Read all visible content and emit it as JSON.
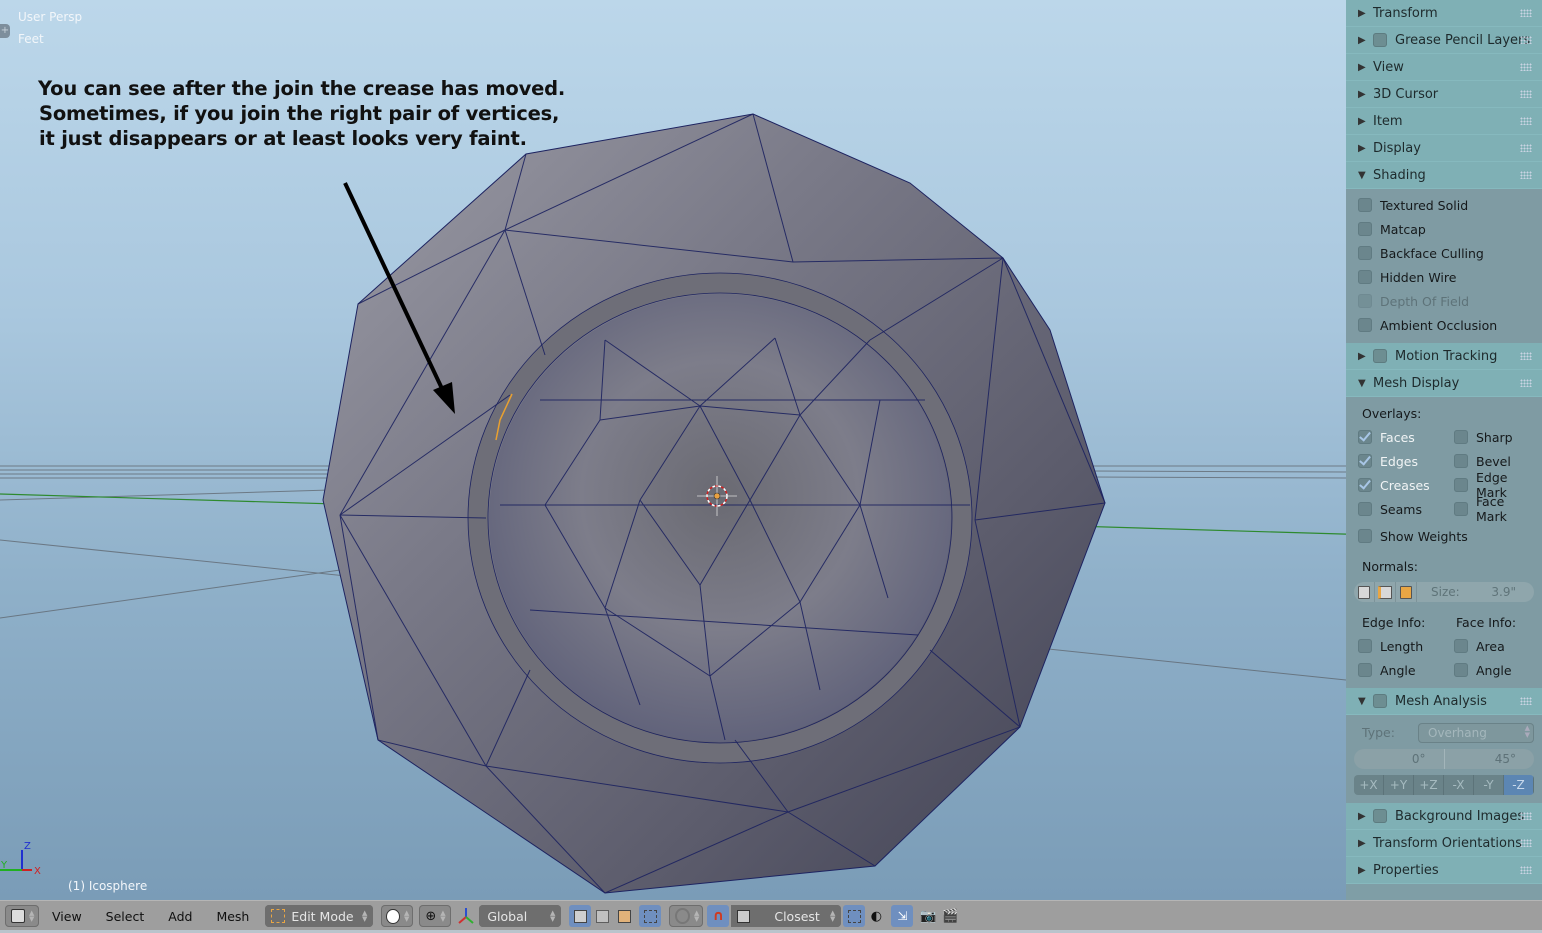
{
  "viewport": {
    "view_name": "User Persp",
    "units": "Feet",
    "object_label": "(1) Icosphere",
    "annotation_lines": [
      "You can see after the join the crease has moved.",
      "Sometimes, if you join the right pair of vertices,",
      "it just disappears or at least looks very faint."
    ],
    "axis_labels": {
      "x": "X",
      "y": "Y",
      "z": "Z"
    }
  },
  "panel": {
    "collapsed_top": [
      {
        "label": "Transform",
        "has_checkbox": false
      },
      {
        "label": "Grease Pencil Layers",
        "has_checkbox": true
      },
      {
        "label": "View",
        "has_checkbox": false
      },
      {
        "label": "3D Cursor",
        "has_checkbox": false
      },
      {
        "label": "Item",
        "has_checkbox": false
      },
      {
        "label": "Display",
        "has_checkbox": false
      }
    ],
    "shading": {
      "label": "Shading",
      "options": [
        {
          "label": "Textured Solid",
          "checked": false,
          "enabled": true
        },
        {
          "label": "Matcap",
          "checked": false,
          "enabled": true
        },
        {
          "label": "Backface Culling",
          "checked": false,
          "enabled": true
        },
        {
          "label": "Hidden Wire",
          "checked": false,
          "enabled": true
        },
        {
          "label": "Depth Of Field",
          "checked": false,
          "enabled": false
        },
        {
          "label": "Ambient Occlusion",
          "checked": false,
          "enabled": true
        }
      ]
    },
    "motion_tracking": {
      "label": "Motion Tracking"
    },
    "mesh_display": {
      "label": "Mesh Display",
      "overlays_label": "Overlays:",
      "overlays_left": [
        {
          "label": "Faces",
          "checked": true
        },
        {
          "label": "Edges",
          "checked": true
        },
        {
          "label": "Creases",
          "checked": true
        },
        {
          "label": "Seams",
          "checked": false
        }
      ],
      "overlays_right": [
        {
          "label": "Sharp",
          "checked": false
        },
        {
          "label": "Bevel",
          "checked": false
        },
        {
          "label": "Edge Mark",
          "checked": false
        },
        {
          "label": "Face Mark",
          "checked": false
        }
      ],
      "show_weights": {
        "label": "Show Weights",
        "checked": false
      },
      "normals_label": "Normals:",
      "normals_size_label": "Size:",
      "normals_size_value": "3.9\"",
      "edge_info_label": "Edge Info:",
      "face_info_label": "Face Info:",
      "edge_info": [
        {
          "label": "Length",
          "checked": false
        },
        {
          "label": "Angle",
          "checked": false
        }
      ],
      "face_info": [
        {
          "label": "Area",
          "checked": false
        },
        {
          "label": "Angle",
          "checked": false
        }
      ]
    },
    "mesh_analysis": {
      "label": "Mesh Analysis",
      "type_label": "Type:",
      "type_value": "Overhang",
      "range_min": "0°",
      "range_max": "45°",
      "axes": [
        "+X",
        "+Y",
        "+Z",
        "-X",
        "-Y",
        "-Z"
      ],
      "active_axis": "-Z"
    },
    "collapsed_bottom": [
      {
        "label": "Background Images",
        "has_checkbox": true
      },
      {
        "label": "Transform Orientations",
        "has_checkbox": false
      },
      {
        "label": "Properties",
        "has_checkbox": false
      }
    ]
  },
  "header": {
    "menus": [
      "View",
      "Select",
      "Add",
      "Mesh"
    ],
    "mode": "Edit Mode",
    "orientation": "Global",
    "snap_target": "Closest"
  },
  "colors": {
    "panel_header": "#7fb0b5",
    "panel_body": "#7f9ba3",
    "mesh_edge": "#1d2360",
    "selected_edge": "#e8a030",
    "active_toggle": "#5c86b3"
  }
}
